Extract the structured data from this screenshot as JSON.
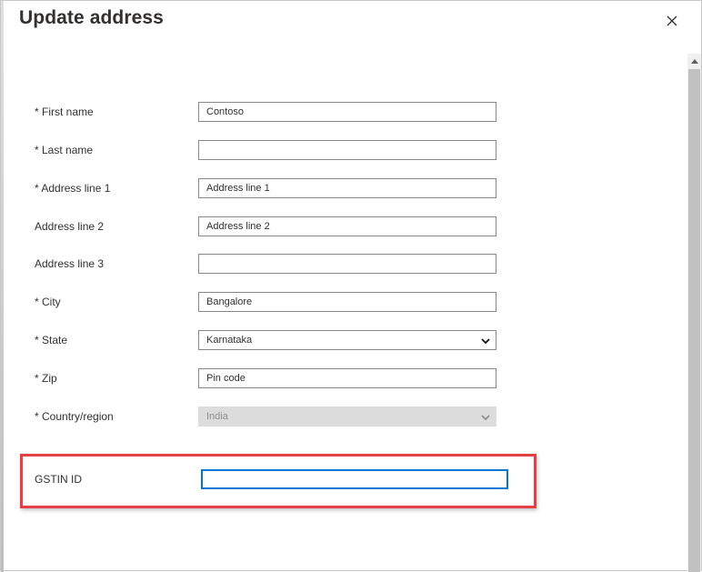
{
  "dialog": {
    "title": "Update address",
    "close_label": "Close"
  },
  "fields": {
    "first_name": {
      "label": "* First name",
      "value": "Contoso"
    },
    "last_name": {
      "label": "* Last name",
      "value": ""
    },
    "address_line_1": {
      "label": "* Address line 1",
      "value": "Address line 1"
    },
    "address_line_2": {
      "label": "Address line 2",
      "value": "Address line 2"
    },
    "address_line_3": {
      "label": "Address line 3",
      "value": ""
    },
    "city": {
      "label": "* City",
      "value": "Bangalore"
    },
    "state": {
      "label": "* State",
      "selected": "Karnataka"
    },
    "zip": {
      "label": "* Zip",
      "value": "Pin code"
    },
    "country": {
      "label": "* Country/region",
      "selected": "India",
      "disabled": true
    },
    "gstin": {
      "label": "GSTIN ID",
      "value": ""
    }
  },
  "colors": {
    "highlight": "#e64046",
    "focus": "#0078d4",
    "disabled_bg": "#dcdcdc"
  },
  "icons": {
    "close": "close-icon",
    "dropdown": "chevron-down-icon",
    "scroll_up": "scroll-up-arrow-icon"
  }
}
